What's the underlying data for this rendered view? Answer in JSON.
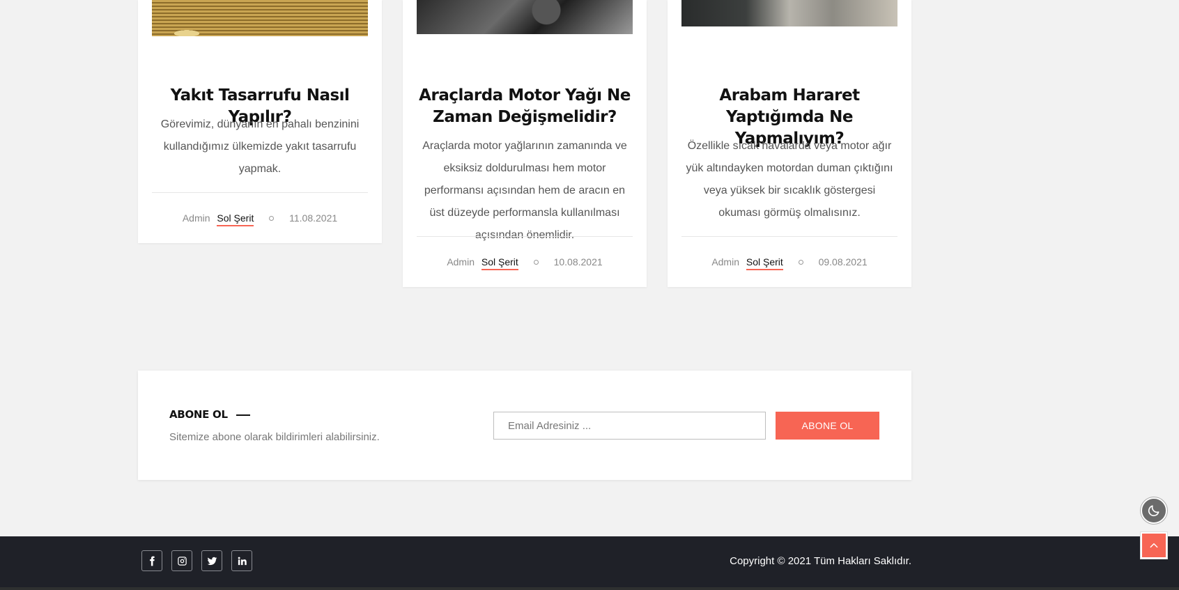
{
  "posts": [
    {
      "title": "Yakıt Tasarrufu Nasıl Yapılır?",
      "excerpt": "Görevimiz, dünyanın en pahalı benzinini kullandığımız ülkemizde yakıt tasarrufu yapmak.",
      "author": "Admin",
      "category": "Sol Şerit",
      "date": "11.08.2021",
      "image": "coins-image"
    },
    {
      "title": "Araçlarda Motor Yağı Ne Zaman Değişmelidir?",
      "excerpt": "Araçlarda motor yağlarının zamanında ve eksiksiz doldurulması hem motor performansı açısından hem de aracın en üst düzeyde performansla kullanılması açısından önemlidir.",
      "author": "Admin",
      "category": "Sol Şerit",
      "date": "10.08.2021",
      "image": "engine-image"
    },
    {
      "title": "Arabam Hararet Yaptığımda Ne Yapmalıyım?",
      "excerpt": "Özellikle sıcak havalarda veya motor ağır yük altındayken motordan duman çıktığını veya yüksek bir sıcaklık göstergesi okuması görmüş olmalısınız.",
      "author": "Admin",
      "category": "Sol Şerit",
      "date": "09.08.2021",
      "image": "road-image"
    }
  ],
  "subscribe": {
    "title": "ABONE OL",
    "description": "Sitemize abone olarak bildirimleri alabilirsiniz.",
    "email_placeholder": "Email Adresiniz ...",
    "button_label": "ABONE OL"
  },
  "footer": {
    "social": [
      "facebook-icon",
      "instagram-icon",
      "twitter-icon",
      "linkedin-icon"
    ],
    "copyright": "Copyright © 2021 Tüm Hakları Saklıdır."
  },
  "floating": {
    "dark_mode_icon": "moon-icon",
    "scroll_top_icon": "chevron-up-icon"
  },
  "colors": {
    "accent": "#f76554",
    "footer_bg": "#1f2128",
    "page_bg": "#f2f2f2"
  }
}
